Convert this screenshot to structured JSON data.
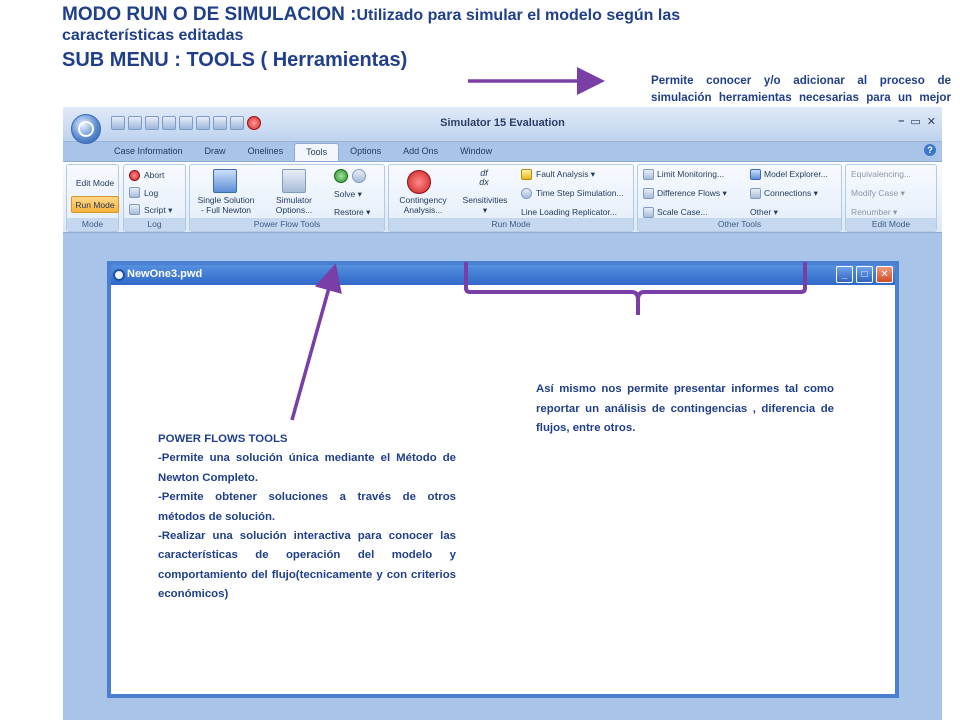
{
  "slide": {
    "title_main": "MODO RUN O DE SIMULACION :",
    "title_rest": "Utilizado para simular el modelo según las",
    "title_line2": "características editadas",
    "submenu": "SUB MENU : TOOLS ( Herramientas)",
    "top_note": "Permite conocer y/o adicionar al proceso de simulación herramientas necesarias para un mejor resultado de observación.",
    "left_note": {
      "heading": "POWER FLOWS TOOLS",
      "p1": "-Permite una solución única mediante el Método de Newton Completo.",
      "p2": "-Permite obtener soluciones a través de otros métodos de solución.",
      "p3": "-Realizar una solución interactiva para conocer las características de operación del modelo y comportamiento del flujo(tecnicamente y con criterios económicos)"
    },
    "right_note": "Así mismo nos permite presentar informes tal como reportar un análisis de contingencias , diferencia de flujos, entre otros.",
    "accent_color": "#1f3f8a",
    "arrow_color": "#7a3fa6"
  },
  "app": {
    "title": "Simulator 15 Evaluation",
    "tabs": [
      "Case Information",
      "Draw",
      "Onelines",
      "Tools",
      "Options",
      "Add Ons",
      "Window"
    ],
    "active_tab": "Tools",
    "help": "?",
    "ribbon": {
      "mode": {
        "label": "Mode",
        "edit": "Edit Mode",
        "run": "Run Mode"
      },
      "log": {
        "label": "Log",
        "abort": "Abort",
        "log": "Log",
        "script": "Script ▾"
      },
      "pft": {
        "label": "Power Flow Tools",
        "single": "Single Solution",
        "single2": "- Full Newton",
        "sim": "Simulator",
        "sim2": "Options...",
        "solve": "Solve ▾",
        "restore": "Restore ▾"
      },
      "run": {
        "label": "Run Mode",
        "cont": "Contingency",
        "cont2": "Analysis...",
        "sens": "Sensitivities",
        "sens2": "▾",
        "fault": "Fault Analysis ▾",
        "tss": "Time Step Simulation...",
        "llr": "Line Loading Replicator..."
      },
      "other": {
        "label": "Other Tools",
        "limit": "Limit Monitoring...",
        "diff": "Difference Flows ▾",
        "scale": "Scale Case...",
        "explorer": "Model Explorer...",
        "conn": "Connections ▾",
        "other": "Other ▾"
      },
      "edit": {
        "label": "Edit Mode",
        "equiv": "Equivalencing...",
        "modify": "Modify Case ▾",
        "renumber": "Renumber ▾"
      }
    },
    "doc_title": "NewOne3.pwd"
  }
}
